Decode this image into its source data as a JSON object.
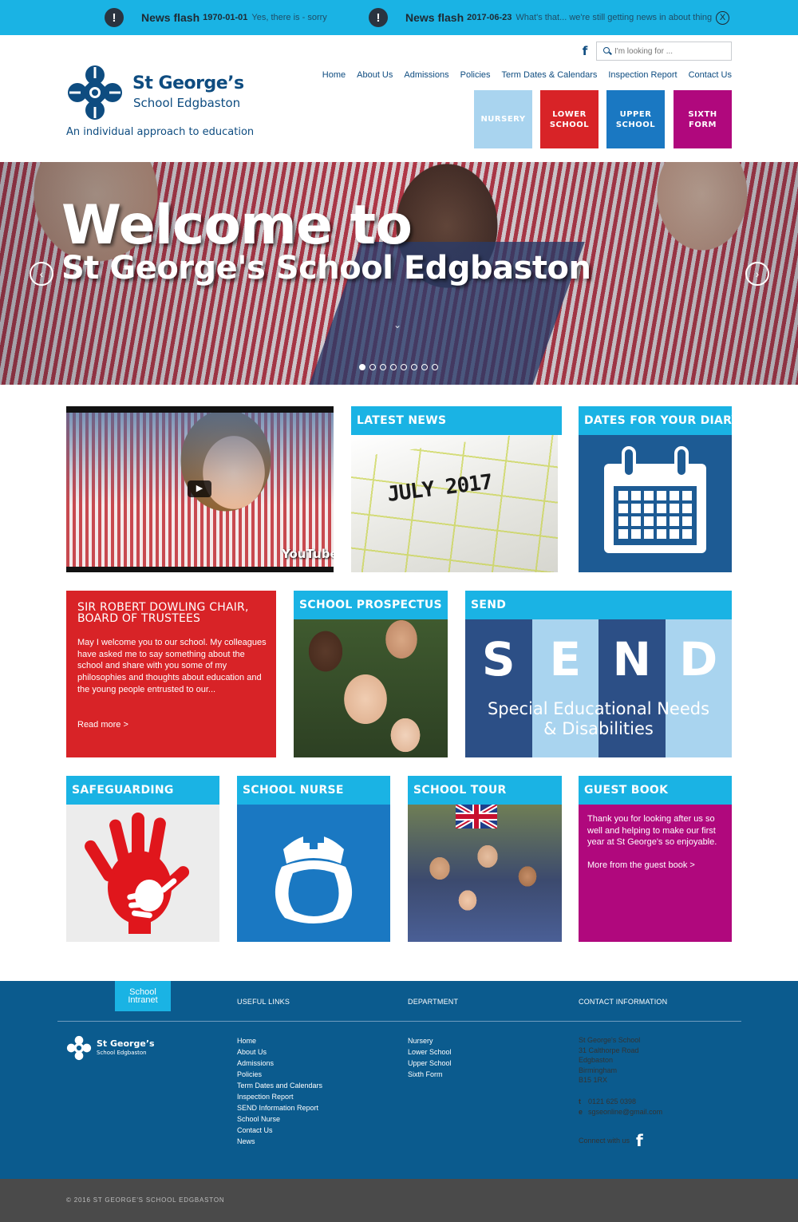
{
  "colors": {
    "accent": "#1ab3e4",
    "brand": "#0e4c80",
    "nursery": "#a9d4ef",
    "lower_school": "#d82327",
    "upper_school": "#1a78c2",
    "sixth_form": "#b0087d",
    "footer": "#0b5b8e",
    "copyright_bar": "#4a4a4a"
  },
  "news": [
    {
      "icon": "alert-icon",
      "glyph": "!",
      "title": "News flash",
      "date": "1970-01-01",
      "text": "Yes, there is - sorry"
    },
    {
      "icon": "alert-icon",
      "glyph": "!",
      "title": "News flash",
      "date": "2017-06-23",
      "text": "What's that... we're still getting news in about thing"
    }
  ],
  "news_close": "X",
  "header": {
    "facebook_glyph": "f",
    "search_placeholder": "I'm looking for ...",
    "school_name": "St George’s",
    "school_sub": "School Edgbaston",
    "tagline": "An individual approach to education"
  },
  "nav": [
    "Home",
    "About Us",
    "Admissions",
    "Policies",
    "Term Dates & Calendars",
    "Inspection Report",
    "Contact Us"
  ],
  "school_buttons": [
    {
      "label": "NURSERY",
      "color": "#a9d4ef"
    },
    {
      "label": "LOWER\nSCHOOL",
      "color": "#d82327"
    },
    {
      "label": "UPPER\nSCHOOL",
      "color": "#1a78c2"
    },
    {
      "label": "SIXTH\nFORM",
      "color": "#b0087d"
    }
  ],
  "hero": {
    "title_line1": "Welcome to",
    "title_line2": "St George's School Edgbaston",
    "prev": "‹",
    "next": "›",
    "down": "⌄",
    "slide_count": 8,
    "active_slide": 0
  },
  "tiles": {
    "video_play": "▶",
    "video_brand": "YouTube",
    "latest_news": "LATEST NEWS",
    "latest_image_text": "JULY 2017",
    "diary": "DATES FOR YOUR DIARY",
    "chair_title": "SIR ROBERT DOWLING CHAIR,\nBOARD OF TRUSTEES",
    "chair_body": "May I welcome you to our school. My colleagues have asked me to say something about the school and share with you some of my philosophies and thoughts about education and the young people entrusted to our...",
    "chair_more": "Read more >",
    "prospectus": "SCHOOL PROSPECTUS",
    "send": "SEND",
    "send_letters": [
      "S",
      "E",
      "N",
      "D"
    ],
    "send_caption": "Special Educational Needs\n& Disabilities",
    "safeguarding": "SAFEGUARDING",
    "nurse": "SCHOOL NURSE",
    "tour": "SCHOOL TOUR",
    "guest": "GUEST BOOK",
    "guest_body": "Thank you for looking after us so well and helping to make our first year at St George's so enjoyable.",
    "guest_more": "More from the guest book >"
  },
  "footer": {
    "intranet": "School\nIntranet",
    "useful_links_heading": "USEFUL LINKS",
    "department_heading": "DEPARTMENT",
    "contact_heading": "CONTACT INFORMATION",
    "logo_name": "St George’s",
    "logo_sub": "School Edgbaston",
    "useful_links": [
      "Home",
      "About Us",
      "Admissions",
      "Policies",
      "Term Dates and Calendars",
      "Inspection Report",
      "SEND Information Report",
      "School Nurse",
      "Contact Us",
      "News"
    ],
    "departments": [
      "Nursery",
      "Lower School",
      "Upper School",
      "Sixth Form"
    ],
    "address": "St George's School\n31 Calthorpe Road\nEdgbaston\nBirmingham\nB15 1RX",
    "phone_label": "t",
    "phone": "0121 625 0398",
    "email_label": "e",
    "email": "sgseonline@gmail.com",
    "connect": "Connect with us",
    "facebook_glyph": "f",
    "copyright": "© 2016 ST GEORGE'S SCHOOL EDGBASTON"
  }
}
